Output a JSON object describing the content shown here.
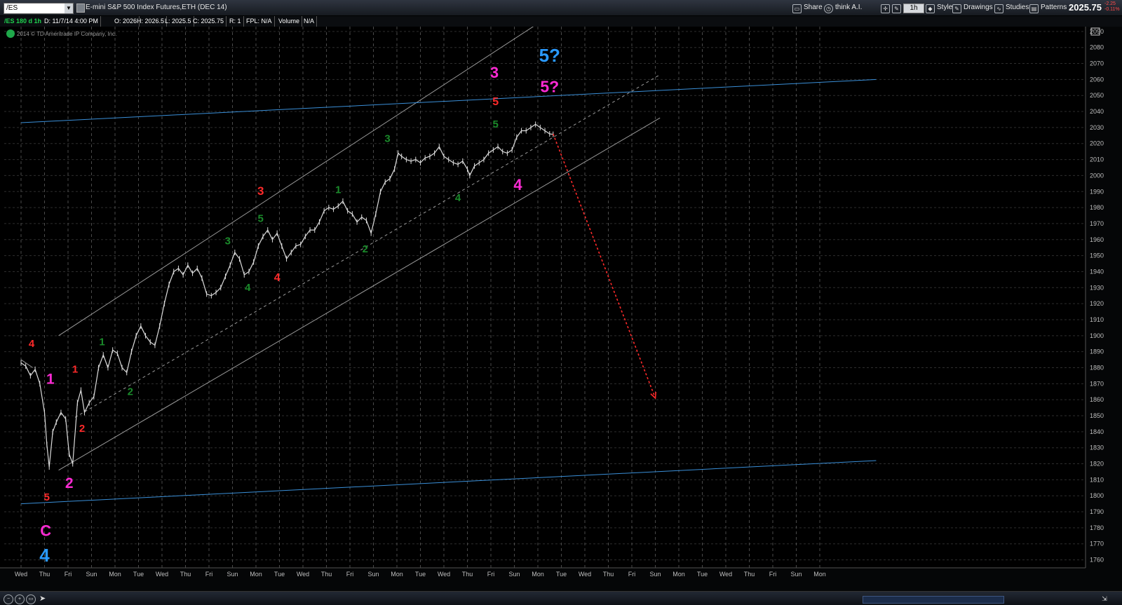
{
  "toolbar": {
    "symbol": "/ES",
    "instrument_title": "E-mini S&P 500 Index Futures,ETH (DEC 14)",
    "share": "Share",
    "think": "think A.I.",
    "timeframe": "1h",
    "style": "Style",
    "drawings": "Drawings",
    "studies": "Studies",
    "patterns": "Patterns",
    "last_price": "2025.75",
    "change1": "-2.25",
    "change2": "-0.11%"
  },
  "status": {
    "symbol_period": "/ES 180 d 1h",
    "date": "D: 11/7/14 4:00 PM",
    "open": "O: 2026",
    "high": "H: 2026.5",
    "low": "L: 2025.5",
    "close": "C: 2025.75",
    "r": "R: 1",
    "fpl": "FPL: N/A",
    "volume_label": "Volume",
    "volume_value": "N/A",
    "copyright": "2014 © TD Ameritrade IP Company, Inc."
  },
  "colors": {
    "background": "#000000",
    "price": "#dcdcdc",
    "channel": "#9a9a9a",
    "trendline": "#3a8fd8",
    "forecast": "#ff2a2a",
    "wave_green": "#1a8a2a",
    "wave_red": "#ff2a2a",
    "wave_magenta": "#ff2ad4",
    "wave_blue": "#2a9aff"
  },
  "chart_data": {
    "type": "line",
    "title": "",
    "y_ticks": [
      1760,
      1770,
      1780,
      1790,
      1800,
      1810,
      1820,
      1830,
      1840,
      1850,
      1860,
      1870,
      1880,
      1890,
      1900,
      1910,
      1920,
      1930,
      1940,
      1950,
      1960,
      1970,
      1980,
      1990,
      2000,
      2010,
      2020,
      2030,
      2040,
      2050,
      2060,
      2070,
      2080,
      2090
    ],
    "ylim": [
      1755,
      2093
    ],
    "x_day_labels": [
      "Wed",
      "Thu",
      "Fri",
      "Sun",
      "Mon",
      "Tue",
      "Wed",
      "Thu",
      "Fri",
      "Sun",
      "Mon",
      "Tue",
      "Wed",
      "Thu",
      "Fri",
      "Sun",
      "Mon",
      "Tue",
      "Wed",
      "Thu",
      "Fri",
      "Sun",
      "Mon",
      "Tue",
      "Wed",
      "Thu",
      "Fri",
      "Sun",
      "Mon",
      "Tue",
      "Wed",
      "Thu",
      "Fri",
      "Sun",
      "Mon"
    ],
    "grid": true,
    "price_path": [
      {
        "d": 0.0,
        "v": 1883
      },
      {
        "d": 0.2,
        "v": 1881
      },
      {
        "d": 0.4,
        "v": 1875
      },
      {
        "d": 0.6,
        "v": 1879
      },
      {
        "d": 0.8,
        "v": 1870
      },
      {
        "d": 1.0,
        "v": 1852
      },
      {
        "d": 1.1,
        "v": 1832
      },
      {
        "d": 1.2,
        "v": 1818
      },
      {
        "d": 1.35,
        "v": 1840
      },
      {
        "d": 1.5,
        "v": 1846
      },
      {
        "d": 1.7,
        "v": 1852
      },
      {
        "d": 1.9,
        "v": 1848
      },
      {
        "d": 2.05,
        "v": 1826
      },
      {
        "d": 2.2,
        "v": 1820
      },
      {
        "d": 2.4,
        "v": 1858
      },
      {
        "d": 2.55,
        "v": 1866
      },
      {
        "d": 2.7,
        "v": 1852
      },
      {
        "d": 2.9,
        "v": 1858
      },
      {
        "d": 3.1,
        "v": 1862
      },
      {
        "d": 3.3,
        "v": 1880
      },
      {
        "d": 3.5,
        "v": 1888
      },
      {
        "d": 3.7,
        "v": 1880
      },
      {
        "d": 3.9,
        "v": 1891
      },
      {
        "d": 4.1,
        "v": 1889
      },
      {
        "d": 4.3,
        "v": 1880
      },
      {
        "d": 4.5,
        "v": 1877
      },
      {
        "d": 4.7,
        "v": 1890
      },
      {
        "d": 4.9,
        "v": 1900
      },
      {
        "d": 5.1,
        "v": 1906
      },
      {
        "d": 5.3,
        "v": 1900
      },
      {
        "d": 5.5,
        "v": 1896
      },
      {
        "d": 5.7,
        "v": 1894
      },
      {
        "d": 5.9,
        "v": 1906
      },
      {
        "d": 6.1,
        "v": 1920
      },
      {
        "d": 6.3,
        "v": 1932
      },
      {
        "d": 6.5,
        "v": 1940
      },
      {
        "d": 6.7,
        "v": 1942
      },
      {
        "d": 6.9,
        "v": 1938
      },
      {
        "d": 7.1,
        "v": 1944
      },
      {
        "d": 7.3,
        "v": 1939
      },
      {
        "d": 7.5,
        "v": 1942
      },
      {
        "d": 7.7,
        "v": 1936
      },
      {
        "d": 7.9,
        "v": 1926
      },
      {
        "d": 8.1,
        "v": 1925
      },
      {
        "d": 8.3,
        "v": 1927
      },
      {
        "d": 8.5,
        "v": 1930
      },
      {
        "d": 8.7,
        "v": 1937
      },
      {
        "d": 8.9,
        "v": 1944
      },
      {
        "d": 9.1,
        "v": 1952
      },
      {
        "d": 9.3,
        "v": 1948
      },
      {
        "d": 9.5,
        "v": 1938
      },
      {
        "d": 9.7,
        "v": 1940
      },
      {
        "d": 9.9,
        "v": 1946
      },
      {
        "d": 10.1,
        "v": 1956
      },
      {
        "d": 10.3,
        "v": 1962
      },
      {
        "d": 10.5,
        "v": 1966
      },
      {
        "d": 10.7,
        "v": 1960
      },
      {
        "d": 10.9,
        "v": 1964
      },
      {
        "d": 11.1,
        "v": 1956
      },
      {
        "d": 11.3,
        "v": 1948
      },
      {
        "d": 11.5,
        "v": 1952
      },
      {
        "d": 11.7,
        "v": 1956
      },
      {
        "d": 11.9,
        "v": 1957
      },
      {
        "d": 12.1,
        "v": 1962
      },
      {
        "d": 12.3,
        "v": 1966
      },
      {
        "d": 12.5,
        "v": 1966
      },
      {
        "d": 12.7,
        "v": 1971
      },
      {
        "d": 12.9,
        "v": 1978
      },
      {
        "d": 13.1,
        "v": 1980
      },
      {
        "d": 13.3,
        "v": 1979
      },
      {
        "d": 13.5,
        "v": 1981
      },
      {
        "d": 13.7,
        "v": 1984
      },
      {
        "d": 13.9,
        "v": 1978
      },
      {
        "d": 14.1,
        "v": 1976
      },
      {
        "d": 14.3,
        "v": 1971
      },
      {
        "d": 14.5,
        "v": 1974
      },
      {
        "d": 14.7,
        "v": 1972
      },
      {
        "d": 14.9,
        "v": 1964
      },
      {
        "d": 15.1,
        "v": 1976
      },
      {
        "d": 15.3,
        "v": 1990
      },
      {
        "d": 15.5,
        "v": 1996
      },
      {
        "d": 15.7,
        "v": 1998
      },
      {
        "d": 15.9,
        "v": 2004
      },
      {
        "d": 16.05,
        "v": 2014
      },
      {
        "d": 16.2,
        "v": 2012
      },
      {
        "d": 16.4,
        "v": 2010
      },
      {
        "d": 16.6,
        "v": 2009
      },
      {
        "d": 16.8,
        "v": 2010
      },
      {
        "d": 17.0,
        "v": 2008
      },
      {
        "d": 17.2,
        "v": 2011
      },
      {
        "d": 17.4,
        "v": 2012
      },
      {
        "d": 17.6,
        "v": 2014
      },
      {
        "d": 17.8,
        "v": 2018
      },
      {
        "d": 18.0,
        "v": 2012
      },
      {
        "d": 18.2,
        "v": 2010
      },
      {
        "d": 18.4,
        "v": 2008
      },
      {
        "d": 18.6,
        "v": 2007
      },
      {
        "d": 18.8,
        "v": 2009
      },
      {
        "d": 19.0,
        "v": 2004
      },
      {
        "d": 19.1,
        "v": 2000
      },
      {
        "d": 19.3,
        "v": 2006
      },
      {
        "d": 19.5,
        "v": 2008
      },
      {
        "d": 19.7,
        "v": 2010
      },
      {
        "d": 19.9,
        "v": 2014
      },
      {
        "d": 20.1,
        "v": 2016
      },
      {
        "d": 20.3,
        "v": 2018
      },
      {
        "d": 20.5,
        "v": 2015
      },
      {
        "d": 20.7,
        "v": 2014
      },
      {
        "d": 20.9,
        "v": 2016
      },
      {
        "d": 21.1,
        "v": 2024
      },
      {
        "d": 21.3,
        "v": 2028
      },
      {
        "d": 21.5,
        "v": 2028
      },
      {
        "d": 21.7,
        "v": 2030
      },
      {
        "d": 21.9,
        "v": 2032
      },
      {
        "d": 22.1,
        "v": 2030
      },
      {
        "d": 22.3,
        "v": 2028
      },
      {
        "d": 22.5,
        "v": 2026
      },
      {
        "d": 22.65,
        "v": 2025.75
      }
    ],
    "forecast": {
      "from_d": 22.65,
      "from_v": 2026,
      "to_d": 27.0,
      "to_v": 1861
    },
    "lines": [
      {
        "name": "channel-upper",
        "style": "solid",
        "color_key": "channel",
        "from_d": 1.6,
        "from_v": 1900,
        "to_d": 24.1,
        "to_v": 2115
      },
      {
        "name": "channel-lower",
        "style": "solid",
        "color_key": "channel",
        "from_d": 1.6,
        "from_v": 1816,
        "to_d": 27.2,
        "to_v": 2036
      },
      {
        "name": "channel-mid",
        "style": "dashed",
        "color_key": "channel",
        "from_d": 2.3,
        "from_v": 1849,
        "to_d": 27.2,
        "to_v": 2063
      },
      {
        "name": "left-stub",
        "style": "solid",
        "color_key": "channel",
        "from_d": 0.0,
        "from_v": 1885,
        "to_d": 0.5,
        "to_v": 1880
      },
      {
        "name": "trend-upper",
        "style": "solid",
        "color_key": "trendline",
        "from_d": 0.0,
        "from_v": 2033,
        "to_d": 36.4,
        "to_v": 2060
      },
      {
        "name": "trend-lower",
        "style": "solid",
        "color_key": "trendline",
        "from_d": 0.0,
        "from_v": 1795,
        "to_d": 36.4,
        "to_v": 1822
      }
    ],
    "wave_labels": [
      {
        "text": "4",
        "color_key": "wave_red",
        "size": 15,
        "d": 0.45,
        "v": 1893
      },
      {
        "text": "1",
        "color_key": "wave_magenta",
        "size": 21,
        "d": 1.25,
        "v": 1870
      },
      {
        "text": "5",
        "color_key": "wave_red",
        "size": 15,
        "d": 1.1,
        "v": 1797
      },
      {
        "text": "C",
        "color_key": "wave_magenta",
        "size": 22,
        "d": 1.05,
        "v": 1775
      },
      {
        "text": "4",
        "color_key": "wave_blue",
        "size": 26,
        "d": 1.0,
        "v": 1759
      },
      {
        "text": "2",
        "color_key": "wave_magenta",
        "size": 21,
        "d": 2.05,
        "v": 1805
      },
      {
        "text": "1",
        "color_key": "wave_red",
        "size": 15,
        "d": 2.3,
        "v": 1877
      },
      {
        "text": "2",
        "color_key": "wave_red",
        "size": 15,
        "d": 2.6,
        "v": 1840
      },
      {
        "text": "1",
        "color_key": "wave_green",
        "size": 15,
        "d": 3.45,
        "v": 1894
      },
      {
        "text": "2",
        "color_key": "wave_green",
        "size": 15,
        "d": 4.65,
        "v": 1863
      },
      {
        "text": "3",
        "color_key": "wave_green",
        "size": 15,
        "d": 8.8,
        "v": 1957
      },
      {
        "text": "4",
        "color_key": "wave_green",
        "size": 15,
        "d": 9.65,
        "v": 1928
      },
      {
        "text": "5",
        "color_key": "wave_green",
        "size": 15,
        "d": 10.2,
        "v": 1971
      },
      {
        "text": "3",
        "color_key": "wave_red",
        "size": 17,
        "d": 10.2,
        "v": 1988
      },
      {
        "text": "4",
        "color_key": "wave_red",
        "size": 16,
        "d": 10.9,
        "v": 1934
      },
      {
        "text": "1",
        "color_key": "wave_green",
        "size": 15,
        "d": 13.5,
        "v": 1989
      },
      {
        "text": "2",
        "color_key": "wave_green",
        "size": 15,
        "d": 14.65,
        "v": 1952
      },
      {
        "text": "3",
        "color_key": "wave_green",
        "size": 15,
        "d": 15.6,
        "v": 2021
      },
      {
        "text": "4",
        "color_key": "wave_green",
        "size": 15,
        "d": 18.6,
        "v": 1984
      },
      {
        "text": "5",
        "color_key": "wave_red",
        "size": 16,
        "d": 20.2,
        "v": 2044
      },
      {
        "text": "5",
        "color_key": "wave_green",
        "size": 15,
        "d": 20.2,
        "v": 2030
      },
      {
        "text": "3",
        "color_key": "wave_magenta",
        "size": 22,
        "d": 20.15,
        "v": 2061
      },
      {
        "text": "4",
        "color_key": "wave_magenta",
        "size": 22,
        "d": 21.15,
        "v": 1991
      },
      {
        "text": "5?",
        "color_key": "wave_blue",
        "size": 26,
        "d": 22.5,
        "v": 2071
      },
      {
        "text": "5?",
        "color_key": "wave_magenta",
        "size": 23,
        "d": 22.5,
        "v": 2052
      }
    ]
  }
}
